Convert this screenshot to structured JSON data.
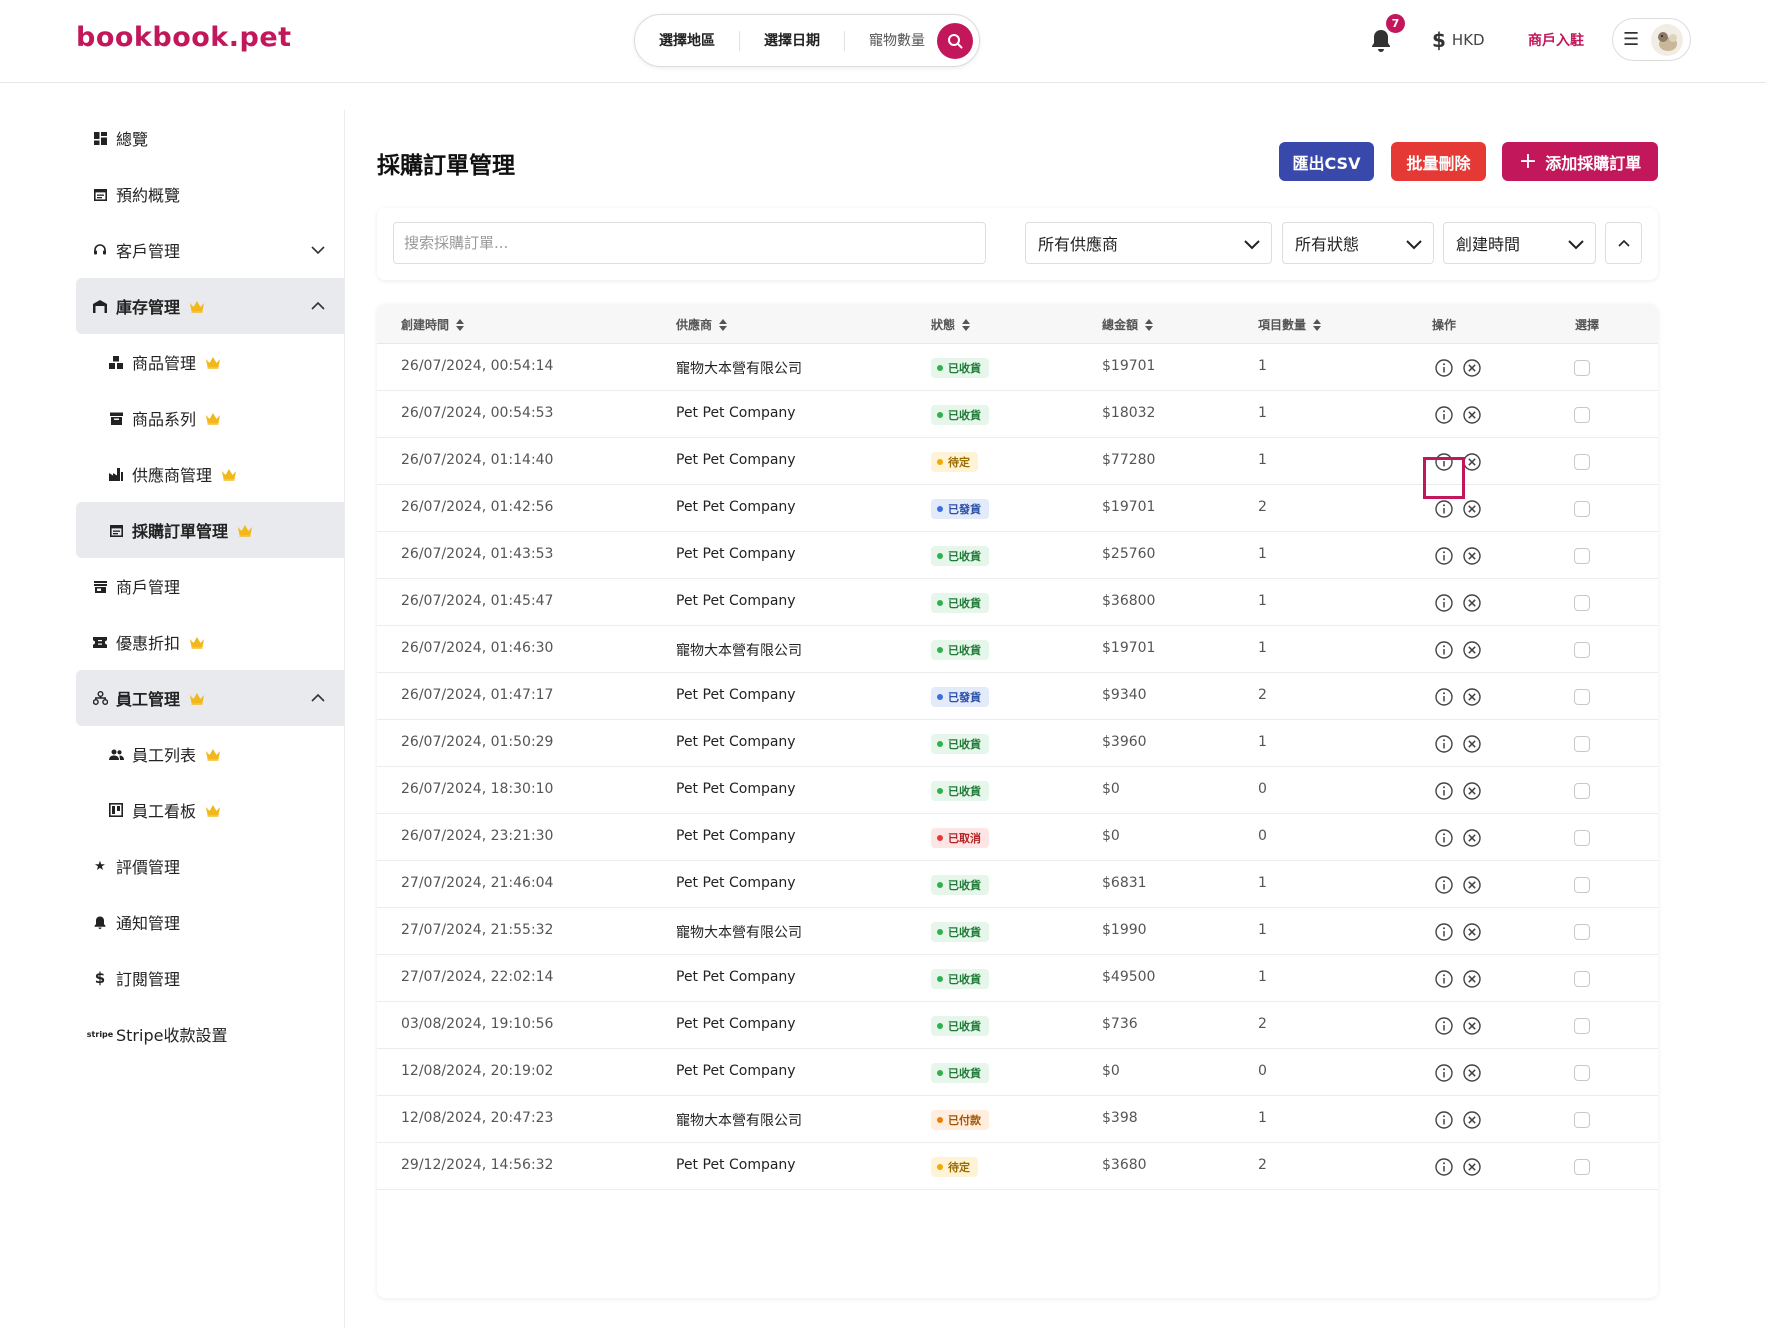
{
  "header": {
    "logo": "bookbook.pet",
    "search": {
      "region": "選擇地區",
      "date": "選擇日期",
      "pets": "寵物數量"
    },
    "notification_count": "7",
    "currency": "HKD",
    "merchant_link": "商戶入駐"
  },
  "colors": {
    "brand": "#c2185b",
    "csv": "#3949ab",
    "delete": "#e53935"
  },
  "sidebar": {
    "items": [
      {
        "label": "總覽",
        "icon": "dashboard-icon"
      },
      {
        "label": "預約概覽",
        "icon": "calendar-icon"
      },
      {
        "label": "客戶管理",
        "icon": "headset-icon"
      },
      {
        "label": "庫存管理",
        "icon": "warehouse-icon"
      },
      {
        "label": "商品管理",
        "icon": "boxes-icon"
      },
      {
        "label": "商品系列",
        "icon": "archive-icon"
      },
      {
        "label": "供應商管理",
        "icon": "factory-icon"
      },
      {
        "label": "採購訂單管理",
        "icon": "calendar-icon"
      },
      {
        "label": "商戶管理",
        "icon": "store-icon"
      },
      {
        "label": "優惠折扣",
        "icon": "ticket-icon"
      },
      {
        "label": "員工管理",
        "icon": "org-chart-icon"
      },
      {
        "label": "員工列表",
        "icon": "people-icon"
      },
      {
        "label": "員工看板",
        "icon": "board-icon"
      },
      {
        "label": "評價管理",
        "icon": "star-icon"
      },
      {
        "label": "通知管理",
        "icon": "bell-icon"
      },
      {
        "label": "訂閱管理",
        "icon": "dollar-icon"
      },
      {
        "label": "Stripe收款設置",
        "icon": "stripe-icon"
      }
    ]
  },
  "main": {
    "title": "採購訂單管理",
    "export_label": "匯出CSV",
    "bulk_delete_label": "批量刪除",
    "add_label": "添加採購訂單",
    "search_placeholder": "搜索採購訂單...",
    "filter_supplier": "所有供應商",
    "filter_status": "所有狀態",
    "filter_sort": "創建時間"
  },
  "table": {
    "headers": {
      "time": "創建時間",
      "supplier": "供應商",
      "status": "狀態",
      "total": "總金額",
      "items": "項目數量",
      "actions": "操作",
      "select": "選擇"
    },
    "rows": [
      {
        "time": "26/07/2024, 00:54:14",
        "supplier": "寵物大本營有限公司",
        "status": "已收貨",
        "kind": "received",
        "total": "$19701",
        "items": "1"
      },
      {
        "time": "26/07/2024, 00:54:53",
        "supplier": "Pet Pet Company",
        "status": "已收貨",
        "kind": "received",
        "total": "$18032",
        "items": "1"
      },
      {
        "time": "26/07/2024, 01:14:40",
        "supplier": "Pet Pet Company",
        "status": "待定",
        "kind": "pending",
        "total": "$77280",
        "items": "1"
      },
      {
        "time": "26/07/2024, 01:42:56",
        "supplier": "Pet Pet Company",
        "status": "已發貨",
        "kind": "shipped",
        "total": "$19701",
        "items": "2"
      },
      {
        "time": "26/07/2024, 01:43:53",
        "supplier": "Pet Pet Company",
        "status": "已收貨",
        "kind": "received",
        "total": "$25760",
        "items": "1"
      },
      {
        "time": "26/07/2024, 01:45:47",
        "supplier": "Pet Pet Company",
        "status": "已收貨",
        "kind": "received",
        "total": "$36800",
        "items": "1"
      },
      {
        "time": "26/07/2024, 01:46:30",
        "supplier": "寵物大本營有限公司",
        "status": "已收貨",
        "kind": "received",
        "total": "$19701",
        "items": "1"
      },
      {
        "time": "26/07/2024, 01:47:17",
        "supplier": "Pet Pet Company",
        "status": "已發貨",
        "kind": "shipped",
        "total": "$9340",
        "items": "2"
      },
      {
        "time": "26/07/2024, 01:50:29",
        "supplier": "Pet Pet Company",
        "status": "已收貨",
        "kind": "received",
        "total": "$3960",
        "items": "1"
      },
      {
        "time": "26/07/2024, 18:30:10",
        "supplier": "Pet Pet Company",
        "status": "已收貨",
        "kind": "received",
        "total": "$0",
        "items": "0"
      },
      {
        "time": "26/07/2024, 23:21:30",
        "supplier": "Pet Pet Company",
        "status": "已取消",
        "kind": "cancelled",
        "total": "$0",
        "items": "0"
      },
      {
        "time": "27/07/2024, 21:46:04",
        "supplier": "Pet Pet Company",
        "status": "已收貨",
        "kind": "received",
        "total": "$6831",
        "items": "1"
      },
      {
        "time": "27/07/2024, 21:55:32",
        "supplier": "寵物大本營有限公司",
        "status": "已收貨",
        "kind": "received",
        "total": "$1990",
        "items": "1"
      },
      {
        "time": "27/07/2024, 22:02:14",
        "supplier": "Pet Pet Company",
        "status": "已收貨",
        "kind": "received",
        "total": "$49500",
        "items": "1"
      },
      {
        "time": "03/08/2024, 19:10:56",
        "supplier": "Pet Pet Company",
        "status": "已收貨",
        "kind": "received",
        "total": "$736",
        "items": "2"
      },
      {
        "time": "12/08/2024, 20:19:02",
        "supplier": "Pet Pet Company",
        "status": "已收貨",
        "kind": "received",
        "total": "$0",
        "items": "0"
      },
      {
        "time": "12/08/2024, 20:47:23",
        "supplier": "寵物大本營有限公司",
        "status": "已付款",
        "kind": "paid",
        "total": "$398",
        "items": "1"
      },
      {
        "time": "29/12/2024, 14:56:32",
        "supplier": "Pet Pet Company",
        "status": "待定",
        "kind": "pending",
        "total": "$3680",
        "items": "2"
      }
    ]
  }
}
